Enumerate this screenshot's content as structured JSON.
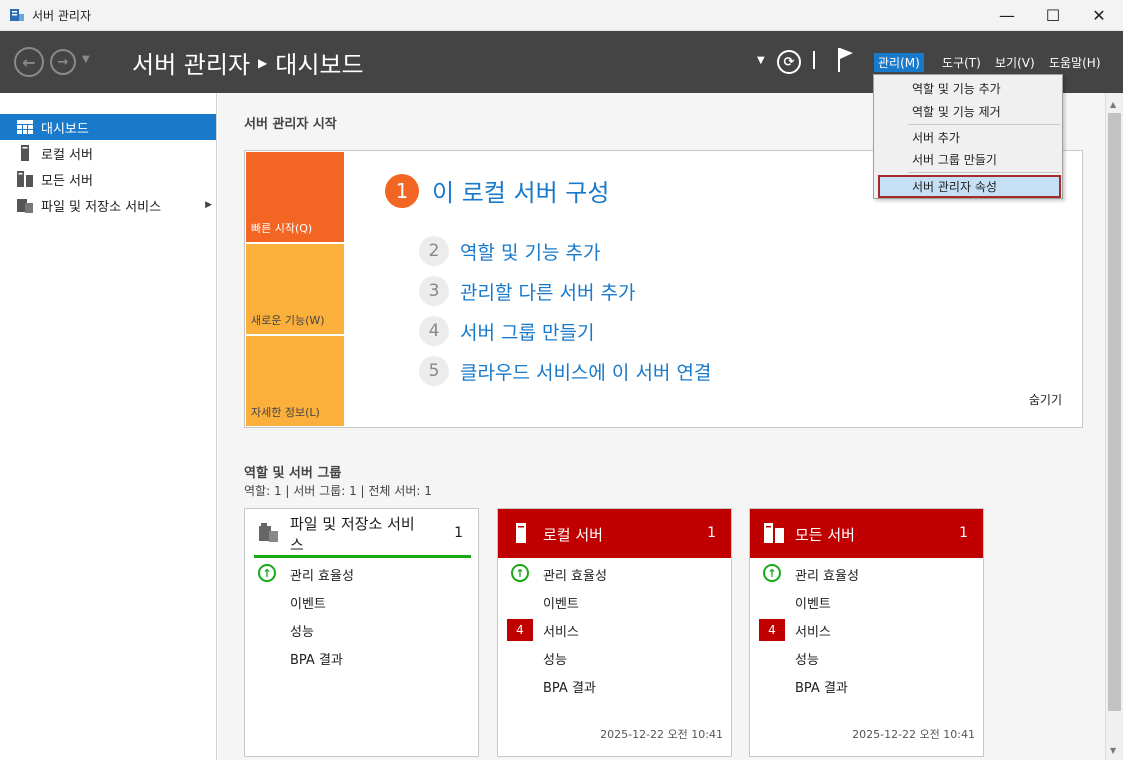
{
  "window": {
    "title": "서버 관리자",
    "minimize": "—",
    "maximize": "☐",
    "close": "✕"
  },
  "header": {
    "breadcrumb_app": "서버 관리자",
    "breadcrumb_page": "대시보드",
    "menus": {
      "manage": "관리(M)",
      "tools": "도구(T)",
      "view": "보기(V)",
      "help": "도움말(H)"
    }
  },
  "sidebar": {
    "items": [
      {
        "label": "대시보드",
        "icon": "dashboard-icon",
        "active": true
      },
      {
        "label": "로컬 서버",
        "icon": "local-server-icon"
      },
      {
        "label": "모든 서버",
        "icon": "all-servers-icon"
      },
      {
        "label": "파일 및 저장소 서비스",
        "icon": "file-storage-icon",
        "expandable": true
      }
    ]
  },
  "quick_start": {
    "section_title": "서버 관리자 시작",
    "tiles": [
      "빠른 시작(Q)",
      "새로운 기능(W)",
      "자세한 정보(L)"
    ],
    "main_step": {
      "num": "1",
      "label": "이 로컬 서버 구성"
    },
    "steps": [
      {
        "num": "2",
        "label": "역할 및 기능 추가"
      },
      {
        "num": "3",
        "label": "관리할 다른 서버 추가"
      },
      {
        "num": "4",
        "label": "서버 그룹 만들기"
      },
      {
        "num": "5",
        "label": "클라우드 서비스에 이 서버 연결"
      }
    ],
    "hide": "숨기기"
  },
  "roles": {
    "section_title": "역할 및 서버 그룹",
    "stats": "역할: 1   |   서버 그룹: 1   |   전체 서버: 1",
    "cards": [
      {
        "title": "파일 및 저장소 서비\n스",
        "count": "1",
        "rows": [
          "관리 효율성",
          "이벤트",
          "성능",
          "BPA 결과"
        ]
      },
      {
        "title": "로컬 서버",
        "count": "1",
        "rows": [
          "관리 효율성",
          "이벤트",
          "서비스",
          "성능",
          "BPA 결과"
        ],
        "services_badge": "4",
        "timestamp": "2025-12-22 오전 10:41"
      },
      {
        "title": "모든 서버",
        "count": "1",
        "rows": [
          "관리 효율성",
          "이벤트",
          "서비스",
          "성능",
          "BPA 결과"
        ],
        "services_badge": "4",
        "timestamp": "2025-12-22 오전 10:41"
      }
    ]
  },
  "manage_menu": {
    "items": [
      "역할 및 기능 추가",
      "역할 및 기능 제거",
      "서버 추가",
      "서버 그룹 만들기",
      "서버 관리자 속성"
    ],
    "highlighted": "서버 관리자 속성"
  },
  "colors": {
    "header_bg": "#444444",
    "accent": "#1979ca",
    "orange": "#f26522",
    "yellow": "#fbb03b",
    "alert_red": "#c00000",
    "ok_green": "#18a818"
  }
}
